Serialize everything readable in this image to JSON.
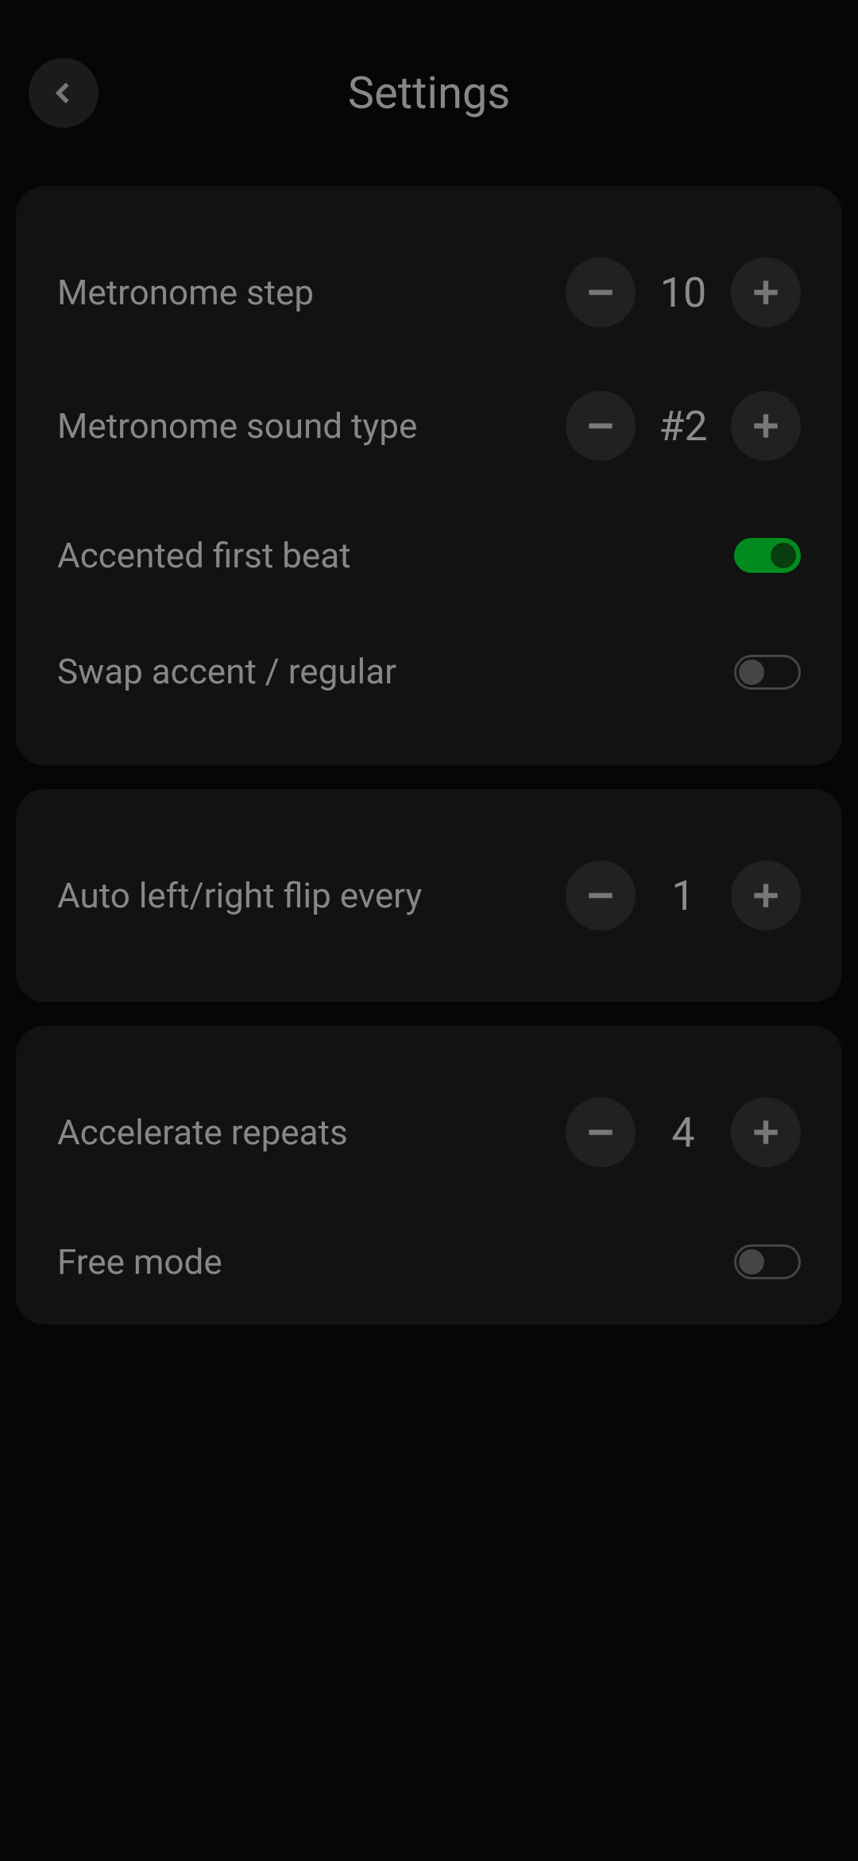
{
  "header": {
    "title": "Settings"
  },
  "card1": {
    "metronome_step": {
      "label": "Metronome step",
      "value": "10"
    },
    "sound_type": {
      "label": "Metronome sound type",
      "value": "#2"
    },
    "accented_first": {
      "label": "Accented first beat",
      "on": true
    },
    "swap_accent": {
      "label": "Swap accent / regular",
      "on": false
    }
  },
  "card2": {
    "auto_flip": {
      "label": "Auto left/right flip every",
      "value": "1"
    }
  },
  "card3": {
    "accelerate": {
      "label": "Accelerate repeats",
      "value": "4"
    },
    "free_mode": {
      "label": "Free mode",
      "on": false
    }
  }
}
